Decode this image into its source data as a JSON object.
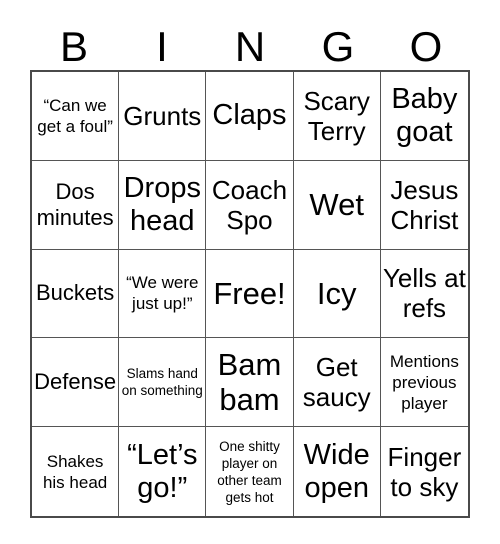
{
  "card": {
    "header_letters": [
      "B",
      "I",
      "N",
      "G",
      "O"
    ],
    "colors": {
      "background": "#ffffff",
      "text": "#000000",
      "grid_line": "#555555",
      "grid_border": "#4a4a4a"
    },
    "rows": [
      [
        {
          "text": "“Can we get a foul”",
          "size": "xs"
        },
        {
          "text": "Grunts",
          "size": "md"
        },
        {
          "text": "Claps",
          "size": "lg"
        },
        {
          "text": "Scary Terry",
          "size": "md"
        },
        {
          "text": "Baby goat",
          "size": "lg"
        }
      ],
      [
        {
          "text": "Dos minutes",
          "size": "sm"
        },
        {
          "text": "Drops head",
          "size": "lg"
        },
        {
          "text": "Coach Spo",
          "size": "md"
        },
        {
          "text": "Wet",
          "size": "xl"
        },
        {
          "text": "Jesus Christ",
          "size": "md"
        }
      ],
      [
        {
          "text": "Buckets",
          "size": "sm"
        },
        {
          "text": "“We were just up!”",
          "size": "xs"
        },
        {
          "text": "Free!",
          "size": "xl"
        },
        {
          "text": "Icy",
          "size": "xl"
        },
        {
          "text": "Yells at refs",
          "size": "md"
        }
      ],
      [
        {
          "text": "Defense",
          "size": "sm"
        },
        {
          "text": "Slams hand on something",
          "size": "xxs"
        },
        {
          "text": "Bam bam",
          "size": "xl"
        },
        {
          "text": "Get saucy",
          "size": "md"
        },
        {
          "text": "Mentions previous player",
          "size": "xs"
        }
      ],
      [
        {
          "text": "Shakes his head",
          "size": "xs"
        },
        {
          "text": "“Let’s go!”",
          "size": "lg"
        },
        {
          "text": "One shitty player on other team gets hot",
          "size": "xxs"
        },
        {
          "text": "Wide open",
          "size": "lg"
        },
        {
          "text": "Finger to sky",
          "size": "md"
        }
      ]
    ]
  }
}
